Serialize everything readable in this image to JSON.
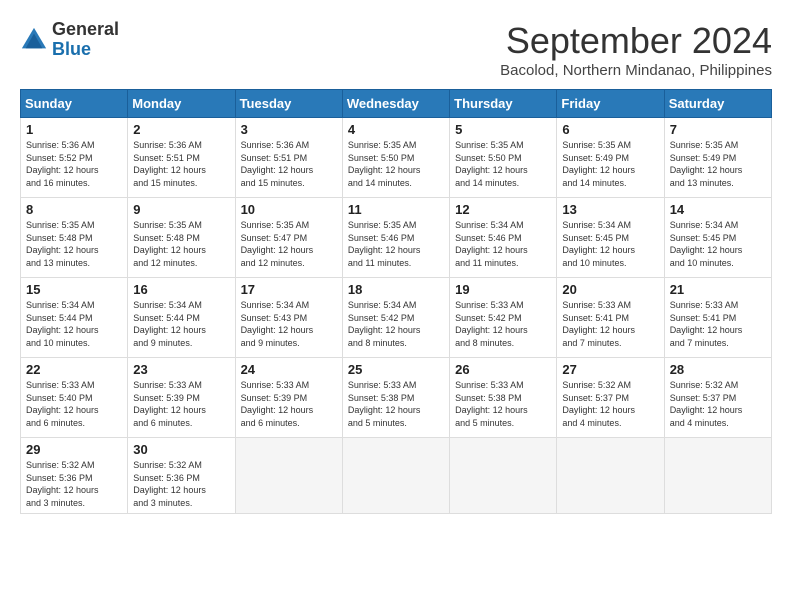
{
  "header": {
    "logo_line1": "General",
    "logo_line2": "Blue",
    "month_title": "September 2024",
    "subtitle": "Bacolod, Northern Mindanao, Philippines"
  },
  "weekdays": [
    "Sunday",
    "Monday",
    "Tuesday",
    "Wednesday",
    "Thursday",
    "Friday",
    "Saturday"
  ],
  "weeks": [
    [
      {
        "day": "1",
        "info": "Sunrise: 5:36 AM\nSunset: 5:52 PM\nDaylight: 12 hours\nand 16 minutes."
      },
      {
        "day": "2",
        "info": "Sunrise: 5:36 AM\nSunset: 5:51 PM\nDaylight: 12 hours\nand 15 minutes."
      },
      {
        "day": "3",
        "info": "Sunrise: 5:36 AM\nSunset: 5:51 PM\nDaylight: 12 hours\nand 15 minutes."
      },
      {
        "day": "4",
        "info": "Sunrise: 5:35 AM\nSunset: 5:50 PM\nDaylight: 12 hours\nand 14 minutes."
      },
      {
        "day": "5",
        "info": "Sunrise: 5:35 AM\nSunset: 5:50 PM\nDaylight: 12 hours\nand 14 minutes."
      },
      {
        "day": "6",
        "info": "Sunrise: 5:35 AM\nSunset: 5:49 PM\nDaylight: 12 hours\nand 14 minutes."
      },
      {
        "day": "7",
        "info": "Sunrise: 5:35 AM\nSunset: 5:49 PM\nDaylight: 12 hours\nand 13 minutes."
      }
    ],
    [
      {
        "day": "8",
        "info": "Sunrise: 5:35 AM\nSunset: 5:48 PM\nDaylight: 12 hours\nand 13 minutes."
      },
      {
        "day": "9",
        "info": "Sunrise: 5:35 AM\nSunset: 5:48 PM\nDaylight: 12 hours\nand 12 minutes."
      },
      {
        "day": "10",
        "info": "Sunrise: 5:35 AM\nSunset: 5:47 PM\nDaylight: 12 hours\nand 12 minutes."
      },
      {
        "day": "11",
        "info": "Sunrise: 5:35 AM\nSunset: 5:46 PM\nDaylight: 12 hours\nand 11 minutes."
      },
      {
        "day": "12",
        "info": "Sunrise: 5:34 AM\nSunset: 5:46 PM\nDaylight: 12 hours\nand 11 minutes."
      },
      {
        "day": "13",
        "info": "Sunrise: 5:34 AM\nSunset: 5:45 PM\nDaylight: 12 hours\nand 10 minutes."
      },
      {
        "day": "14",
        "info": "Sunrise: 5:34 AM\nSunset: 5:45 PM\nDaylight: 12 hours\nand 10 minutes."
      }
    ],
    [
      {
        "day": "15",
        "info": "Sunrise: 5:34 AM\nSunset: 5:44 PM\nDaylight: 12 hours\nand 10 minutes."
      },
      {
        "day": "16",
        "info": "Sunrise: 5:34 AM\nSunset: 5:44 PM\nDaylight: 12 hours\nand 9 minutes."
      },
      {
        "day": "17",
        "info": "Sunrise: 5:34 AM\nSunset: 5:43 PM\nDaylight: 12 hours\nand 9 minutes."
      },
      {
        "day": "18",
        "info": "Sunrise: 5:34 AM\nSunset: 5:42 PM\nDaylight: 12 hours\nand 8 minutes."
      },
      {
        "day": "19",
        "info": "Sunrise: 5:33 AM\nSunset: 5:42 PM\nDaylight: 12 hours\nand 8 minutes."
      },
      {
        "day": "20",
        "info": "Sunrise: 5:33 AM\nSunset: 5:41 PM\nDaylight: 12 hours\nand 7 minutes."
      },
      {
        "day": "21",
        "info": "Sunrise: 5:33 AM\nSunset: 5:41 PM\nDaylight: 12 hours\nand 7 minutes."
      }
    ],
    [
      {
        "day": "22",
        "info": "Sunrise: 5:33 AM\nSunset: 5:40 PM\nDaylight: 12 hours\nand 6 minutes."
      },
      {
        "day": "23",
        "info": "Sunrise: 5:33 AM\nSunset: 5:39 PM\nDaylight: 12 hours\nand 6 minutes."
      },
      {
        "day": "24",
        "info": "Sunrise: 5:33 AM\nSunset: 5:39 PM\nDaylight: 12 hours\nand 6 minutes."
      },
      {
        "day": "25",
        "info": "Sunrise: 5:33 AM\nSunset: 5:38 PM\nDaylight: 12 hours\nand 5 minutes."
      },
      {
        "day": "26",
        "info": "Sunrise: 5:33 AM\nSunset: 5:38 PM\nDaylight: 12 hours\nand 5 minutes."
      },
      {
        "day": "27",
        "info": "Sunrise: 5:32 AM\nSunset: 5:37 PM\nDaylight: 12 hours\nand 4 minutes."
      },
      {
        "day": "28",
        "info": "Sunrise: 5:32 AM\nSunset: 5:37 PM\nDaylight: 12 hours\nand 4 minutes."
      }
    ],
    [
      {
        "day": "29",
        "info": "Sunrise: 5:32 AM\nSunset: 5:36 PM\nDaylight: 12 hours\nand 3 minutes."
      },
      {
        "day": "30",
        "info": "Sunrise: 5:32 AM\nSunset: 5:36 PM\nDaylight: 12 hours\nand 3 minutes."
      },
      null,
      null,
      null,
      null,
      null
    ]
  ]
}
